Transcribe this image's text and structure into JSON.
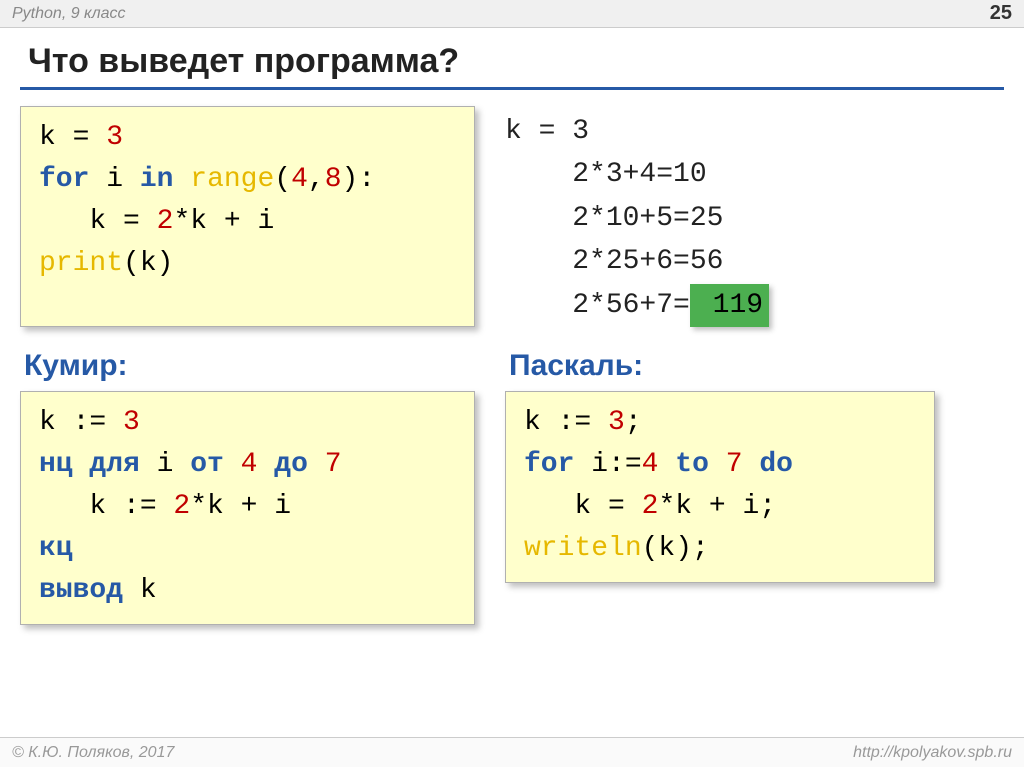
{
  "header": {
    "left": "Python, 9 класс",
    "page": "25"
  },
  "title": "Что выведет программа?",
  "python": {
    "l1_a": "k = ",
    "l1_n": "3",
    "l2_a": "for",
    "l2_b": " i ",
    "l2_c": "in",
    "l2_d": " ",
    "l2_e": "range",
    "l2_f": "(",
    "l2_g": "4",
    "l2_h": ",",
    "l2_i": "8",
    "l2_j": "):",
    "l3_a": "   k = ",
    "l3_b": "2",
    "l3_c": "*k + i",
    "l4_a": "print",
    "l4_b": "(k)"
  },
  "calc": {
    "l1": "k = 3",
    "l2": "    2*3+4=10",
    "l3": "    2*10+5=25",
    "l4": "    2*25+6=56",
    "l5a": "    2*56+7=",
    "answer": " 119"
  },
  "labels": {
    "kumir": "Кумир:",
    "pascal": "Паскаль:"
  },
  "kumir": {
    "l1_a": "k := ",
    "l1_n": "3",
    "l2_a": "нц для",
    "l2_b": " i ",
    "l2_c": "от",
    "l2_d": " ",
    "l2_e": "4",
    "l2_f": " ",
    "l2_g": "до",
    "l2_h": " ",
    "l2_i": "7",
    "l3_a": "   k := ",
    "l3_b": "2",
    "l3_c": "*k + i",
    "l4": "кц",
    "l5_a": "вывод",
    "l5_b": " k"
  },
  "pascal": {
    "l1_a": "k := ",
    "l1_b": "3",
    "l1_c": ";",
    "l2_a": "for",
    "l2_b": " i:=",
    "l2_c": "4",
    "l2_d": " ",
    "l2_e": "to",
    "l2_f": " ",
    "l2_g": "7",
    "l2_h": " ",
    "l2_i": "do",
    "l3_a": "   k = ",
    "l3_b": "2",
    "l3_c": "*k + i;",
    "l4_a": "writeln",
    "l4_b": "(k);"
  },
  "footer": {
    "left": "© К.Ю. Поляков, 2017",
    "right": "http://kpolyakov.spb.ru"
  }
}
